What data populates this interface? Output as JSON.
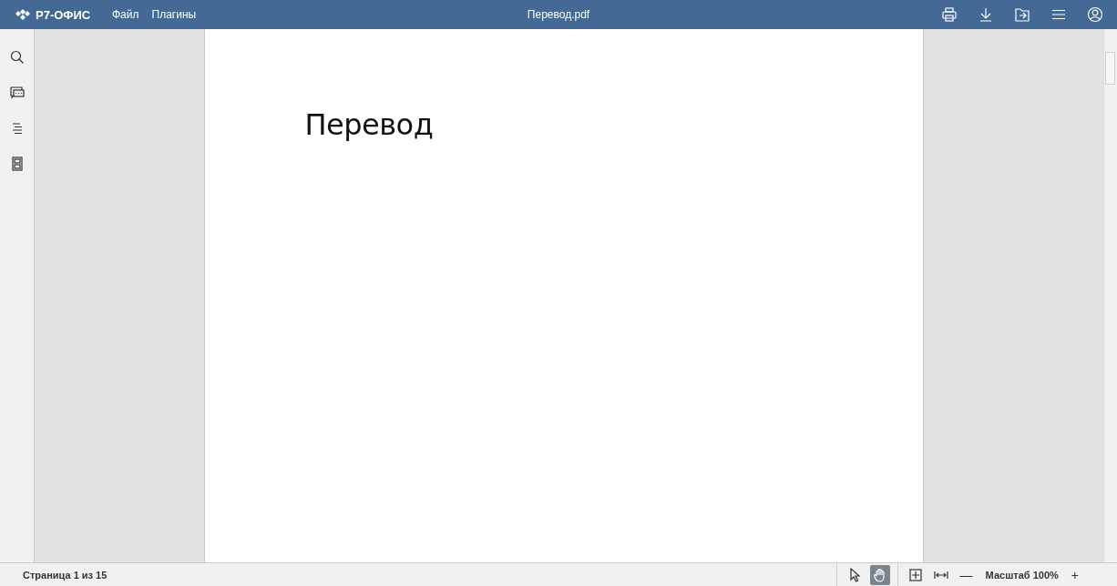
{
  "header": {
    "logo": "Р7-ОФИС",
    "menu": [
      "Файл",
      "Плагины"
    ],
    "title": "Перевод.pdf"
  },
  "sidebar": {
    "items": [
      {
        "kind": "search"
      },
      {
        "kind": "comments"
      },
      {
        "kind": "headings"
      },
      {
        "kind": "thumbnails"
      }
    ]
  },
  "document": {
    "heading": "Перевод"
  },
  "status_bar": {
    "page_info": "Страница 1 из 15",
    "tools": [
      {
        "kind": "select",
        "selected": false
      },
      {
        "kind": "hand",
        "selected": true
      }
    ],
    "zoom_minus": "—",
    "zoom_label": "Масштаб 100%",
    "zoom_plus": "+"
  }
}
